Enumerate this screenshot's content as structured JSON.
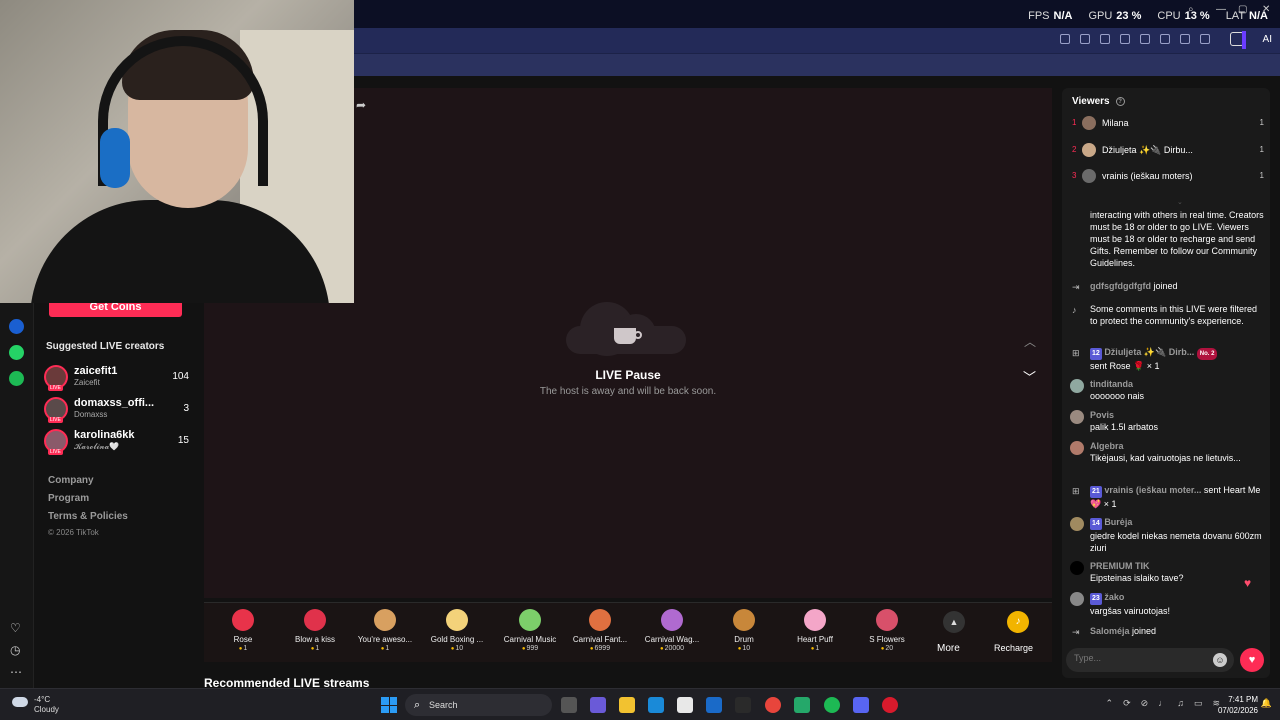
{
  "overlay_stats": {
    "fps_label": "FPS",
    "fps_value": "N/A",
    "gpu_label": "GPU",
    "gpu_value": "23 %",
    "cpu_label": "CPU",
    "cpu_value": "13 %",
    "lat_label": "LAT",
    "lat_value": "N/A"
  },
  "toolbar": {
    "ai_label": "AI"
  },
  "sidebar": {
    "get_coins": "Get Coins",
    "suggested_title": "Suggested LIVE creators",
    "creators": [
      {
        "name": "zaicefit1",
        "sub": "Zaicefit",
        "count": "104",
        "live": "LIVE"
      },
      {
        "name": "domaxss_offi...",
        "sub": "Domaxss",
        "count": "3",
        "live": "LIVE"
      },
      {
        "name": "karolina6kk",
        "sub": "𝓚𝓪𝓻𝓸𝓵𝓲𝓷𝓪🤍",
        "count": "15",
        "live": "LIVE"
      }
    ],
    "footer": [
      "Company",
      "Program",
      "Terms & Policies"
    ],
    "copyright": "© 2026 TikTok"
  },
  "stage": {
    "pause_title": "LIVE Pause",
    "pause_sub": "The host is away and will be back soon."
  },
  "gifts": [
    {
      "name": "Rose",
      "cost": "1",
      "color": "#e8334a"
    },
    {
      "name": "Blow a kiss",
      "cost": "1",
      "color": "#e0324b"
    },
    {
      "name": "You're aweso...",
      "cost": "1",
      "color": "#d8a060"
    },
    {
      "name": "Gold Boxing ...",
      "cost": "10",
      "color": "#f3d27a"
    },
    {
      "name": "Carnival Music",
      "cost": "999",
      "color": "#7ccf6a"
    },
    {
      "name": "Carnival Fant...",
      "cost": "6999",
      "color": "#e07040"
    },
    {
      "name": "Carnival Wag...",
      "cost": "20000",
      "color": "#b06ad0"
    },
    {
      "name": "Drum",
      "cost": "10",
      "color": "#c8873a"
    },
    {
      "name": "Heart Puff",
      "cost": "1",
      "color": "#f4a6c8"
    },
    {
      "name": "S Flowers",
      "cost": "20",
      "color": "#d8506a"
    }
  ],
  "gift_more": "More",
  "recharge": "Recharge",
  "recommended_title": "Recommended LIVE streams",
  "viewers": {
    "title": "Viewers",
    "list": [
      {
        "rank": "1",
        "name": "Milana",
        "n": "1",
        "color": "#8a6e5e"
      },
      {
        "rank": "2",
        "name": "Džiuljeta ✨🔌 Dirbu...",
        "n": "1",
        "color": "#c9a888"
      },
      {
        "rank": "3",
        "name": "vrainis (ieškau moters)",
        "n": "1",
        "color": "#6a6a6a"
      }
    ]
  },
  "chat": {
    "rules_text": "interacting with others in real time. Creators must be 18 or older to go LIVE. Viewers must be 18 or older to recharge and send Gifts. Remember to follow our Community Guidelines.",
    "m1_user": "gdfsgfdgdfgfd",
    "m1_text": "joined",
    "m2_text": "Some comments in this LIVE were filtered to protect the community's experience.",
    "m3_lvl": "12",
    "m3_user": "Džiuljeta ✨🔌 Dirb...",
    "m3_badge": "No. 2",
    "m3_text": "sent Rose 🌹 × 1",
    "m4_user": "tinditanda",
    "m4_text": "ooooooo nais",
    "m5_user": "Povis",
    "m5_text": "palik 1.5l arbatos",
    "m6_user": "Algebra",
    "m6_text": "Tikėjausi, kad vairuotojas ne lietuvis...",
    "m7_lvl": "21",
    "m7_user": "vrainis (ieškau moter...",
    "m7_text": "sent Heart Me 💖 × 1",
    "m8_lvl": "14",
    "m8_user": "Burėja",
    "m8_text": "giedre kodel niekas nemeta dovanu 600zm ziuri",
    "m9_user": "PREMIUM TIK",
    "m9_text": "Eipsteinas islaiko tave?",
    "m10_lvl": "23",
    "m10_user": "žako",
    "m10_text": "vargšas vairuotojas!",
    "m11_user": "Saloméja",
    "m11_text": "joined"
  },
  "chat_input": {
    "placeholder": "Type..."
  },
  "taskbar": {
    "temp": "-4°C",
    "weather": "Cloudy",
    "search": "Search",
    "time": "7:41 PM",
    "date": "07/02/2026"
  }
}
